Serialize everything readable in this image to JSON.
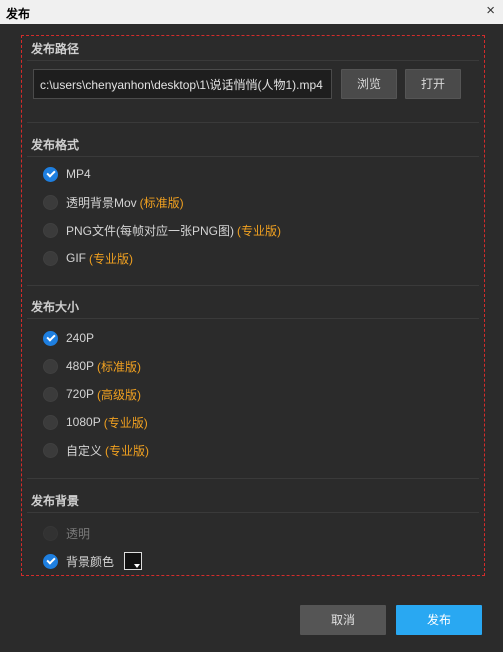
{
  "window": {
    "title": "发布",
    "close_glyph": "×"
  },
  "path_section": {
    "title": "发布路径",
    "path_value": "c:\\users\\chenyanhon\\desktop\\1\\说话悄悄(人物1).mp4",
    "browse_label": "浏览",
    "open_label": "打开"
  },
  "format_section": {
    "title": "发布格式",
    "options": [
      {
        "label": "MP4",
        "tag": "",
        "selected": true
      },
      {
        "label": "透明背景Mov",
        "tag": "(标准版)",
        "selected": false
      },
      {
        "label": "PNG文件(每帧对应一张PNG图)",
        "tag": "(专业版)",
        "selected": false
      },
      {
        "label": "GIF",
        "tag": "(专业版)",
        "selected": false
      }
    ]
  },
  "size_section": {
    "title": "发布大小",
    "options": [
      {
        "label": "240P",
        "tag": "",
        "selected": true
      },
      {
        "label": "480P",
        "tag": "(标准版)",
        "selected": false
      },
      {
        "label": "720P",
        "tag": "(高级版)",
        "selected": false
      },
      {
        "label": "1080P",
        "tag": "(专业版)",
        "selected": false
      },
      {
        "label": "自定义",
        "tag": "(专业版)",
        "selected": false
      }
    ]
  },
  "background_section": {
    "title": "发布背景",
    "options": [
      {
        "label": "透明",
        "selected": false,
        "disabled": true
      },
      {
        "label": "背景颜色",
        "selected": true,
        "disabled": false,
        "swatch_color": "#111111"
      }
    ]
  },
  "footer": {
    "cancel_label": "取消",
    "publish_label": "发布"
  },
  "colors": {
    "accent": "#29a8f2",
    "check": "#1e7fe0",
    "edition_tag": "#f0a020",
    "dashed_frame": "#d42b2b"
  }
}
